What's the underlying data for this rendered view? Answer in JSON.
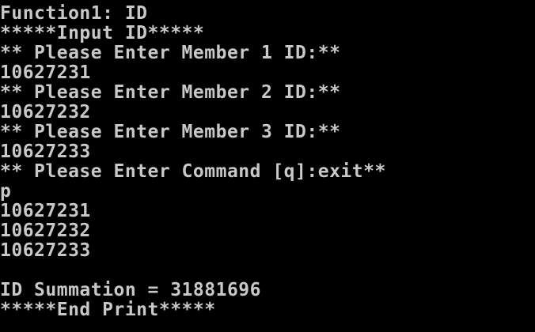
{
  "console": {
    "text_color": "#c8c8c8",
    "background_color": "#000000",
    "lines": [
      "Function1: ID",
      "*****Input ID*****",
      "** Please Enter Member 1 ID:**",
      "10627231",
      "** Please Enter Member 2 ID:**",
      "10627232",
      "** Please Enter Member 3 ID:**",
      "10627233",
      "** Please Enter Command [q]:exit**",
      "p",
      "10627231",
      "10627232",
      "10627233",
      "",
      "ID Summation = 31881696",
      "*****End Print*****"
    ]
  }
}
